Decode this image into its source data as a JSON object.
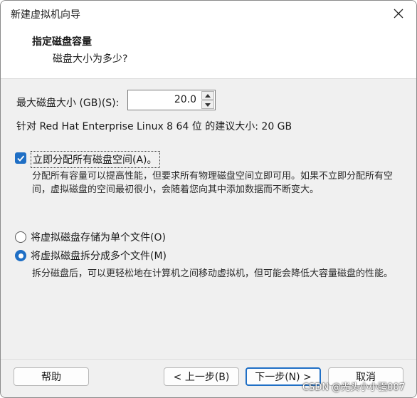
{
  "window": {
    "title": "新建虚拟机向导",
    "close_icon": "close-icon"
  },
  "header": {
    "title": "指定磁盘容量",
    "subtitle": "磁盘大小为多少?"
  },
  "disk_size": {
    "label": "最大磁盘大小 (GB)(S):",
    "value": "20.0",
    "recommendation": "针对 Red Hat Enterprise Linux 8 64 位 的建议大小: 20 GB"
  },
  "allocate_now": {
    "label": "立即分配所有磁盘空间(A)。",
    "checked": true,
    "description": "分配所有容量可以提高性能，但要求所有物理磁盘空间立即可用。如果不立即分配所有空间，虚拟磁盘的空间最初很小，会随着您向其中添加数据而不断变大。"
  },
  "storage_options": {
    "single_file_label": "将虚拟磁盘存储为单个文件(O)",
    "multi_file_label": "将虚拟磁盘拆分成多个文件(M)",
    "selected": "multi",
    "multi_description": "拆分磁盘后，可以更轻松地在计算机之间移动虚拟机，但可能会降低大容量磁盘的性能。"
  },
  "footer": {
    "help_label": "帮助",
    "back_label": "< 上一步(B)",
    "next_label": "下一步(N) >",
    "cancel_label": "取消"
  },
  "watermark": "CSDN @光头小小强007",
  "colors": {
    "accent": "#1f6fc5",
    "background": "#f0f0f0"
  }
}
